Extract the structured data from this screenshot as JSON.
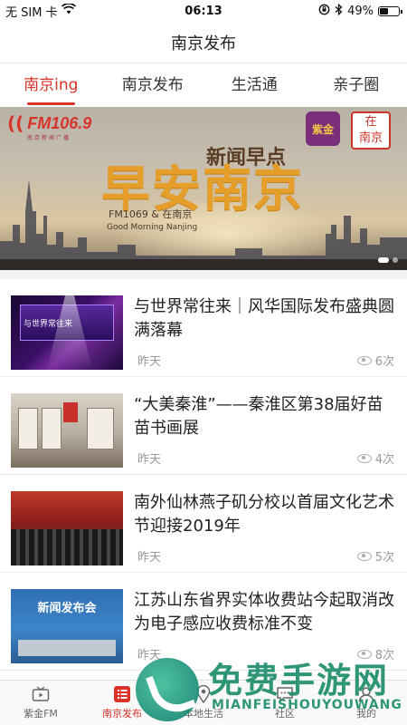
{
  "status_bar": {
    "carrier": "无 SIM 卡",
    "time": "06:13",
    "battery": "49%",
    "battery_level": 0.49
  },
  "title": "南京发布",
  "tabs": [
    {
      "label": "南京ing",
      "active": true
    },
    {
      "label": "南京发布",
      "active": false
    },
    {
      "label": "生活通",
      "active": false
    },
    {
      "label": "亲子圈",
      "active": false
    }
  ],
  "banner": {
    "fm_logo": "FM106.9",
    "fm_subtitle": "南京新闻广播",
    "badge_zijin": "紫金",
    "badge_zai": "在",
    "badge_nanjing": "南京",
    "news_program": "新闻早点",
    "main_title": "早安南京",
    "sub_cn": "FM1069 & 在南京",
    "sub_en": "Good Morning Nanjing",
    "slides": 2,
    "active_slide": 1
  },
  "news": [
    {
      "title": "与世界常往来｜风华国际发布盛典圆满落幕",
      "time": "昨天",
      "views": "6次",
      "thumb_text": "与世界常往来"
    },
    {
      "title": "“大美秦淮”——秦淮区第38届好苗苗书画展",
      "time": "昨天",
      "views": "4次",
      "thumb_text": ""
    },
    {
      "title": "南外仙林燕子矶分校以首届文化艺术节迎接2019年",
      "time": "昨天",
      "views": "5次",
      "thumb_text": ""
    },
    {
      "title": "江苏山东省界实体收费站今起取消改为电子感应收费标准不变",
      "time": "昨天",
      "views": "8次",
      "thumb_text": "新闻发布会"
    }
  ],
  "bottom_nav": [
    {
      "label": "紫金FM",
      "icon": "tv-icon",
      "active": false
    },
    {
      "label": "南京发布",
      "icon": "list-icon",
      "active": true
    },
    {
      "label": "本地生活",
      "icon": "location-icon",
      "active": false
    },
    {
      "label": "社区",
      "icon": "chat-icon",
      "active": false
    },
    {
      "label": "我的",
      "icon": "user-icon",
      "active": false
    }
  ],
  "watermark": {
    "cn": "免费手游网",
    "en": "MIANFEISHOUYOUWANG"
  },
  "colors": {
    "accent": "#d8342a",
    "banner_title": "#e59e2a",
    "watermark": "#1d8e6c"
  }
}
